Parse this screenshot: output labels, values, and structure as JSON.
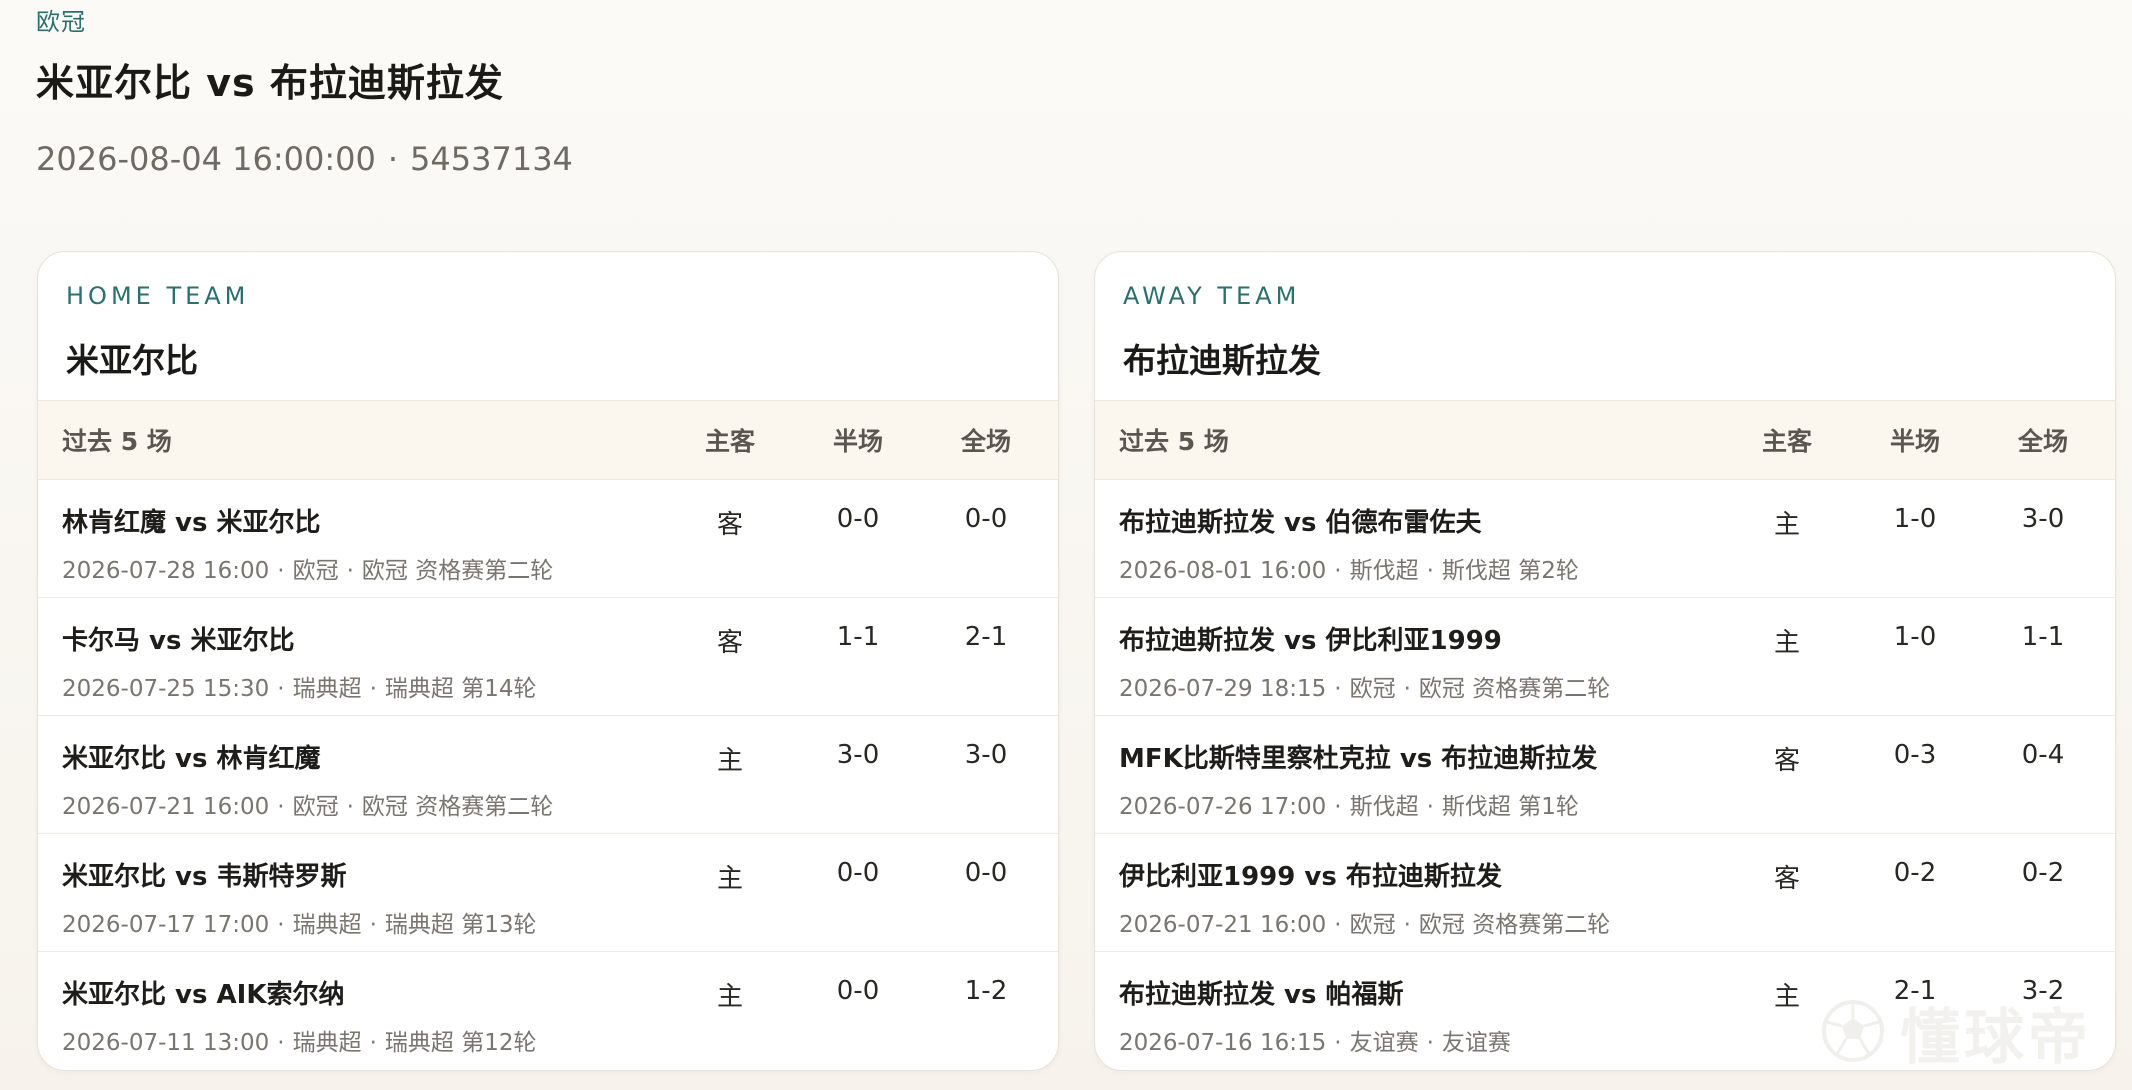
{
  "header": {
    "league": "欧冠",
    "title": "米亚尔比 vs 布拉迪斯拉发",
    "datetime": "2026-08-04 16:00:00",
    "match_id": "54537134",
    "separator": "·"
  },
  "table_headers": {
    "recent": "过去 5 场",
    "home_away": "主客",
    "half": "半场",
    "full": "全场"
  },
  "home": {
    "tag": "HOME TEAM",
    "name": "米亚尔比",
    "matches": [
      {
        "title": "林肯红魔 vs 米亚尔比",
        "date": "2026-07-28 16:00",
        "comp": "欧冠",
        "round": "欧冠 资格赛第二轮",
        "ha": "客",
        "half": "0-0",
        "full": "0-0"
      },
      {
        "title": "卡尔马 vs 米亚尔比",
        "date": "2026-07-25 15:30",
        "comp": "瑞典超",
        "round": "瑞典超 第14轮",
        "ha": "客",
        "half": "1-1",
        "full": "2-1"
      },
      {
        "title": "米亚尔比 vs 林肯红魔",
        "date": "2026-07-21 16:00",
        "comp": "欧冠",
        "round": "欧冠 资格赛第二轮",
        "ha": "主",
        "half": "3-0",
        "full": "3-0"
      },
      {
        "title": "米亚尔比 vs 韦斯特罗斯",
        "date": "2026-07-17 17:00",
        "comp": "瑞典超",
        "round": "瑞典超 第13轮",
        "ha": "主",
        "half": "0-0",
        "full": "0-0"
      },
      {
        "title": "米亚尔比 vs AIK索尔纳",
        "date": "2026-07-11 13:00",
        "comp": "瑞典超",
        "round": "瑞典超 第12轮",
        "ha": "主",
        "half": "0-0",
        "full": "1-2"
      }
    ]
  },
  "away": {
    "tag": "AWAY TEAM",
    "name": "布拉迪斯拉发",
    "matches": [
      {
        "title": "布拉迪斯拉发 vs 伯德布雷佐夫",
        "date": "2026-08-01 16:00",
        "comp": "斯伐超",
        "round": "斯伐超 第2轮",
        "ha": "主",
        "half": "1-0",
        "full": "3-0"
      },
      {
        "title": "布拉迪斯拉发 vs 伊比利亚1999",
        "date": "2026-07-29 18:15",
        "comp": "欧冠",
        "round": "欧冠 资格赛第二轮",
        "ha": "主",
        "half": "1-0",
        "full": "1-1"
      },
      {
        "title": "MFK比斯特里察杜克拉 vs 布拉迪斯拉发",
        "date": "2026-07-26 17:00",
        "comp": "斯伐超",
        "round": "斯伐超 第1轮",
        "ha": "客",
        "half": "0-3",
        "full": "0-4"
      },
      {
        "title": "伊比利亚1999 vs 布拉迪斯拉发",
        "date": "2026-07-21 16:00",
        "comp": "欧冠",
        "round": "欧冠 资格赛第二轮",
        "ha": "客",
        "half": "0-2",
        "full": "0-2"
      },
      {
        "title": "布拉迪斯拉发 vs 帕福斯",
        "date": "2026-07-16 16:15",
        "comp": "友谊赛",
        "round": "友谊赛",
        "ha": "主",
        "half": "2-1",
        "full": "3-2"
      }
    ]
  },
  "watermark": {
    "text": "懂球帝",
    "icon": "soccer-ball-icon"
  }
}
